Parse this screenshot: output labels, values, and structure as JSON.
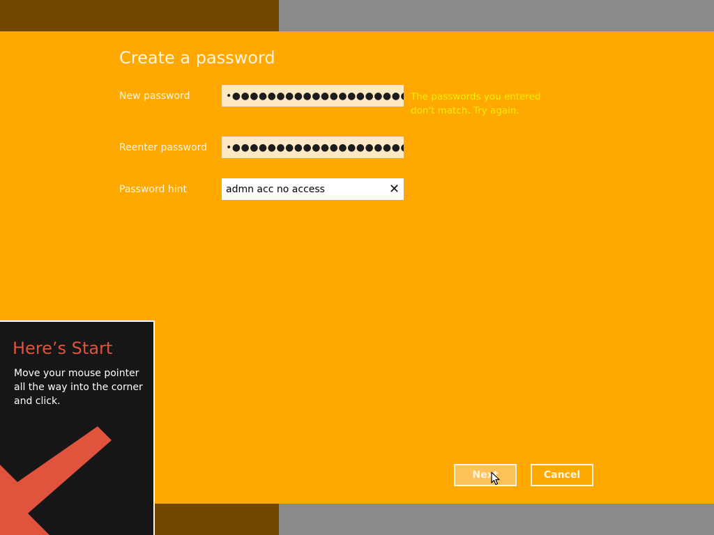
{
  "dialog": {
    "title": "Create a password",
    "fields": {
      "new_password_label": "New password",
      "new_password_mask": "•●●●●●●●●●●●●●●●●●●●●●●●●",
      "reenter_label": "Reenter password",
      "reenter_mask": "•●●●●●●●●●●●●●●●●●●●●●●●●",
      "hint_label": "Password hint",
      "hint_value": "admn acc no access",
      "clear_glyph": "✕"
    },
    "error": "The passwords you entered don't match. Try again.",
    "buttons": {
      "next": "Next",
      "cancel": "Cancel"
    },
    "colors": {
      "background": "#ffa800",
      "error_text": "#f5f000",
      "title_text": "#fff5e0"
    }
  },
  "start_tip": {
    "title": "Here’s Start",
    "body": "Move your mouse pointer all the way into the corner and click.",
    "arrow_icon": "arrow-down-left-icon",
    "colors": {
      "title": "#e0533c",
      "arrow": "#e0533c",
      "background": "#161616"
    }
  }
}
